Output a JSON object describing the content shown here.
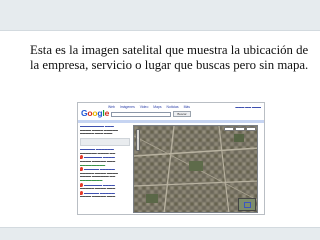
{
  "slide": {
    "caption": "Esta es la imagen satelital que muestra la ubicación de la empresa, servicio o lugar que buscas pero sin mapa."
  },
  "screenshot": {
    "logo": [
      "G",
      "o",
      "o",
      "g",
      "l",
      "e"
    ],
    "nav_tabs": [
      "Web",
      "Imágenes",
      "Video",
      "Maps",
      "Noticias",
      "Más"
    ],
    "search_button": "Buscar",
    "map_view": "satellite"
  }
}
